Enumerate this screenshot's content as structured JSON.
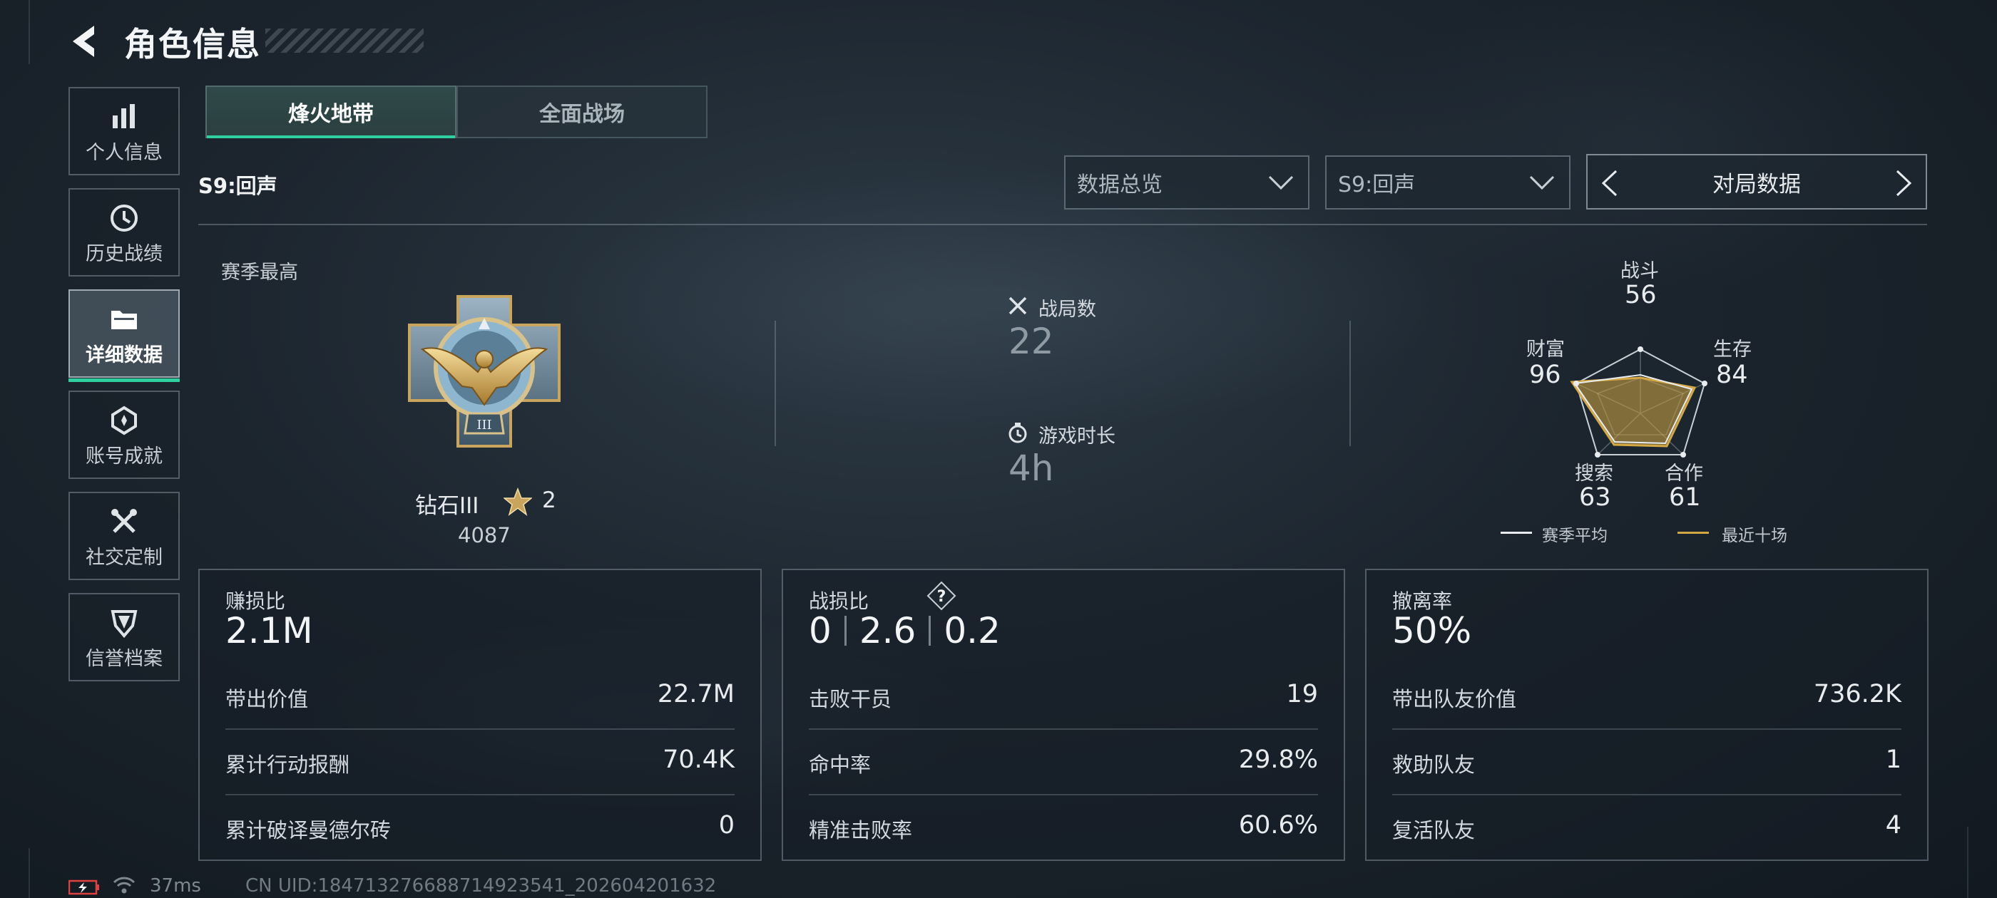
{
  "header": {
    "title": "角色信息"
  },
  "sidebar": {
    "items": [
      {
        "label": "个人信息",
        "icon": "bar-chart-icon",
        "active": false
      },
      {
        "label": "历史战绩",
        "icon": "history-icon",
        "active": false
      },
      {
        "label": "详细数据",
        "icon": "folder-icon",
        "active": true
      },
      {
        "label": "账号成就",
        "icon": "achievement-icon",
        "active": false
      },
      {
        "label": "社交定制",
        "icon": "tools-icon",
        "active": false
      },
      {
        "label": "信誉档案",
        "icon": "shield-icon",
        "active": false
      }
    ]
  },
  "tabs": [
    {
      "label": "烽火地带",
      "active": true
    },
    {
      "label": "全面战场",
      "active": false
    }
  ],
  "season_label": "S9:回声",
  "filters": {
    "view": "数据总览",
    "season": "S9:回声",
    "pager_label": "对局数据"
  },
  "best": {
    "title": "赛季最高",
    "rank": "钻石III",
    "stars": "2",
    "score": "4087"
  },
  "overview": {
    "matches_label": "战局数",
    "matches_value": "22",
    "time_label": "游戏时长",
    "time_value": "4h"
  },
  "radar": {
    "combat_label": "战斗",
    "combat_value": "56",
    "survival_label": "生存",
    "survival_value": "84",
    "coop_label": "合作",
    "coop_value": "61",
    "search_label": "搜索",
    "search_value": "63",
    "wealth_label": "财富",
    "wealth_value": "96",
    "legend_avg": "赛季平均",
    "legend_recent": "最近十场",
    "colors": {
      "avg": "#e8ecef",
      "recent": "#d4a843"
    }
  },
  "cards": {
    "profit": {
      "title": "赚损比",
      "value": "2.1M",
      "rows": [
        {
          "label": "带出价值",
          "value": "22.7M"
        },
        {
          "label": "累计行动报酬",
          "value": "70.4K"
        },
        {
          "label": "累计破译曼德尔砖",
          "value": "0"
        }
      ]
    },
    "kd": {
      "title": "战损比",
      "v1": "0",
      "v2": "2.6",
      "v3": "0.2",
      "help": "?",
      "rows": [
        {
          "label": "击败干员",
          "value": "19"
        },
        {
          "label": "命中率",
          "value": "29.8%"
        },
        {
          "label": "精准击败率",
          "value": "60.6%"
        }
      ]
    },
    "extract": {
      "title": "撤离率",
      "value": "50%",
      "rows": [
        {
          "label": "带出队友价值",
          "value": "736.2K"
        },
        {
          "label": "救助队友",
          "value": "1"
        },
        {
          "label": "复活队友",
          "value": "4"
        }
      ]
    }
  },
  "footer": {
    "ping": "37ms",
    "uid": "CN UID:184713276688714923541_202604201632"
  },
  "accent": "#2fd0a0"
}
